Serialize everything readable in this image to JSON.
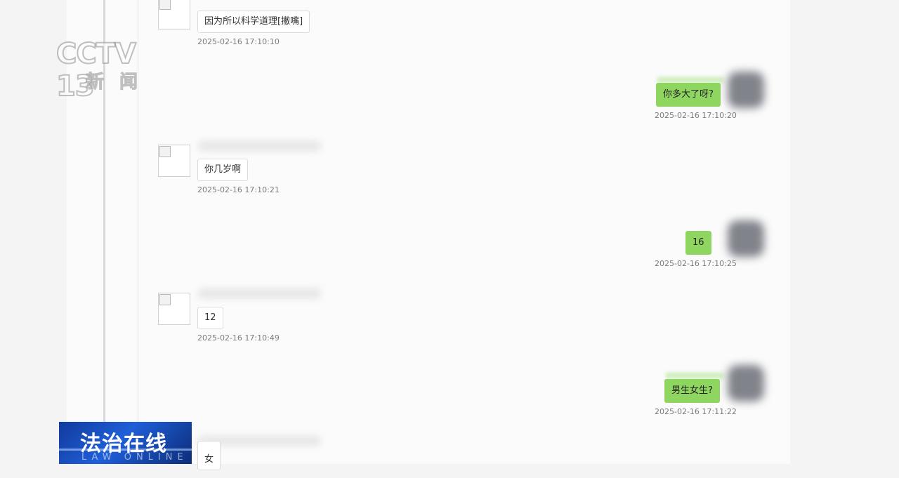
{
  "watermark": {
    "brand": "CCTV 13",
    "sub": "新闻"
  },
  "program": {
    "title": "法治在线",
    "subtitle": "LAW ONLINE"
  },
  "messages": [
    {
      "side": "left",
      "text": "因为所以科学道理[撇嘴]",
      "time": "2025-02-16 17:10:10"
    },
    {
      "side": "right",
      "text": "你多大了呀?",
      "time": "2025-02-16 17:10:20"
    },
    {
      "side": "left",
      "text": "你几岁啊",
      "time": "2025-02-16 17:10:21"
    },
    {
      "side": "right",
      "text": "16",
      "time": "2025-02-16 17:10:25"
    },
    {
      "side": "left",
      "text": "12",
      "time": "2025-02-16 17:10:49"
    },
    {
      "side": "right",
      "text": "男生女生?",
      "time": "2025-02-16 17:11:22"
    },
    {
      "side": "left",
      "text": "女",
      "time": ""
    }
  ]
}
